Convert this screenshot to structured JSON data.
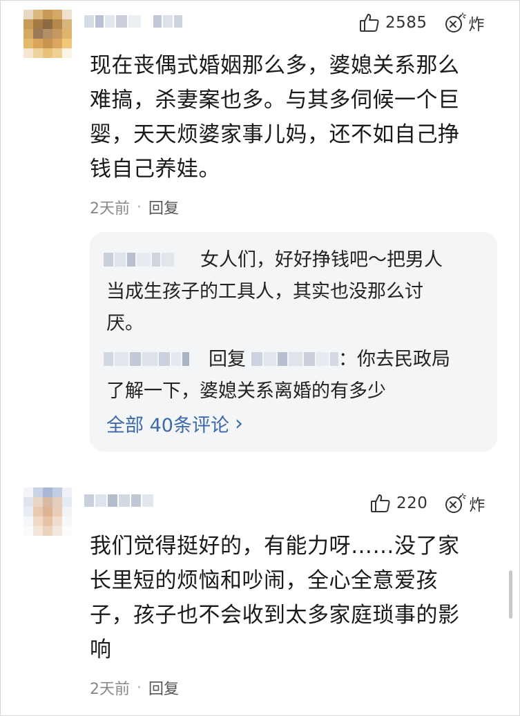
{
  "comments": [
    {
      "likes": "2585",
      "bomb_label": "炸",
      "lines": [
        "现在丧偶式婚姻那么多，婆媳关系那么",
        "难搞，杀妻案也多。与其多伺候一个巨",
        "婴，天天烦婆家事儿妈，还不如自己挣",
        "钱自己养娃。"
      ],
      "time": "2天前",
      "dot": "·",
      "reply_label": "回复"
    },
    {
      "likes": "220",
      "bomb_label": "炸",
      "lines": [
        "我们觉得挺好的，有能力呀……没了家",
        "长里短的烦恼和吵闹，全心全意爱孩",
        "子，孩子也不会收到太多家庭琐事的影",
        "响"
      ],
      "time": "2天前",
      "dot": "·",
      "reply_label": "回复"
    }
  ],
  "replies": {
    "reply1_lines": [
      "女人们，好好挣钱吧～把男人",
      "当成生孩子的工具人，其实也没那么讨",
      "厌。"
    ],
    "reply2_mid": "回复",
    "reply2_tail": "：你去民政局",
    "reply2_line2": "了解一下，婆媳关系离婚的有多少",
    "all_comments": "全部 40条评论",
    "chevron": "›"
  }
}
